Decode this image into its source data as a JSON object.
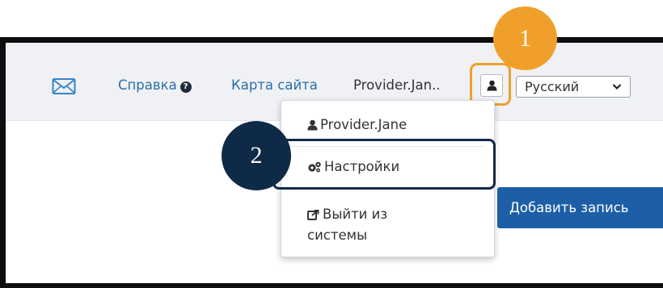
{
  "header": {
    "mail_icon": "envelope-icon",
    "help_label": "Справка",
    "help_icon": "question-circle-icon",
    "sitemap_label": "Карта сайта",
    "username_truncated": "Provider.Jan..",
    "user_menu_icon": "user-icon",
    "language": {
      "selected": "Русский",
      "icon": "chevron-down-icon"
    }
  },
  "callouts": {
    "step1": "1",
    "step2": "2",
    "step1_color": "#f0a02a",
    "step2_color": "#0f2a47"
  },
  "user_menu": {
    "items": [
      {
        "label": "Provider.Jane",
        "icon": "user-icon"
      },
      {
        "label": "Настройки",
        "icon": "gears-icon"
      },
      {
        "label": "Выйти из системы",
        "line1": "Выйти из",
        "line2": "системы",
        "icon": "sign-out-icon"
      }
    ]
  },
  "main": {
    "add_record_label": "Добавить запись"
  },
  "colors": {
    "link": "#2d6ea8",
    "header_bg": "#eff1f5",
    "primary_button": "#1d5ea6"
  }
}
